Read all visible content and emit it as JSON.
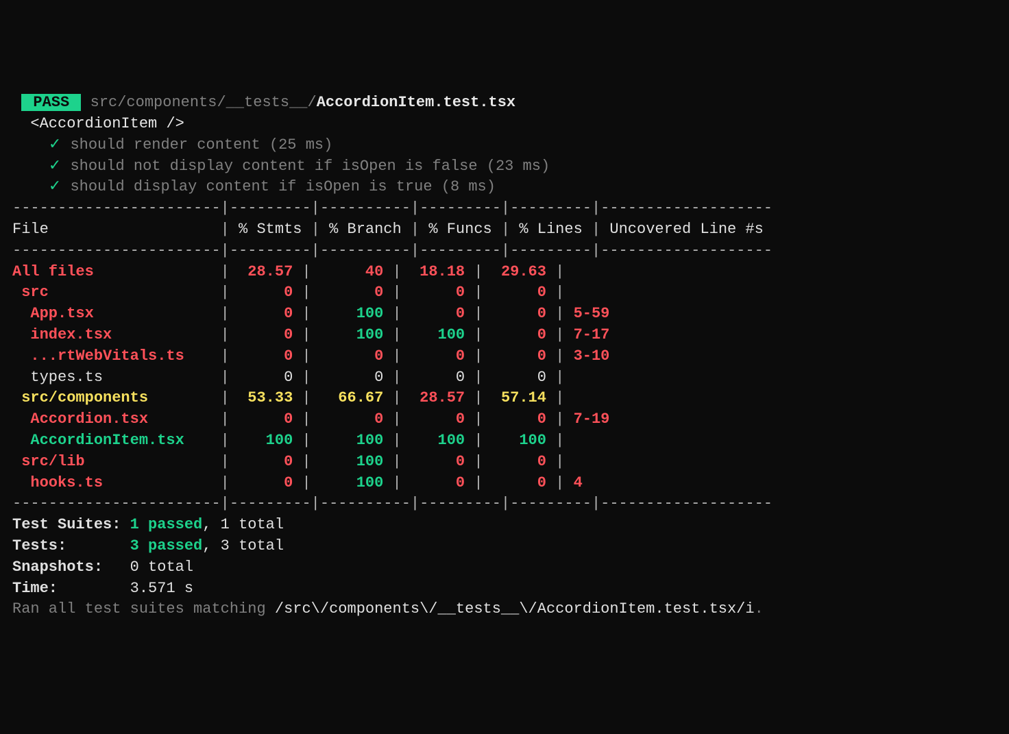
{
  "header": {
    "badge": " PASS ",
    "path_dim": "src/components/__tests__/",
    "path_bold": "AccordionItem.test.tsx"
  },
  "describe": "<AccordionItem />",
  "tests": [
    {
      "name": "should render content",
      "duration": "(25 ms)"
    },
    {
      "name": "should not display content if isOpen is false",
      "duration": "(23 ms)"
    },
    {
      "name": "should display content if isOpen is true",
      "duration": "(8 ms)"
    }
  ],
  "coverage": {
    "rule": "-----------------------|---------|----------|---------|---------|-------------------",
    "header": "File                   | % Stmts | % Branch | % Funcs | % Lines | Uncovered Line #s ",
    "rows": [
      {
        "file": "All files             ",
        "c": [
          "red",
          "red",
          "red",
          "red"
        ],
        "v": [
          "  28.57",
          "      40",
          "  18.18",
          "  29.63"
        ],
        "u": "",
        "fclass": "red"
      },
      {
        "file": " src                  ",
        "c": [
          "red",
          "red",
          "red",
          "red"
        ],
        "v": [
          "      0",
          "       0",
          "      0",
          "      0"
        ],
        "u": "",
        "fclass": "red"
      },
      {
        "file": "  App.tsx             ",
        "c": [
          "red",
          "green",
          "red",
          "red"
        ],
        "v": [
          "      0",
          "     100",
          "      0",
          "      0"
        ],
        "u": "5-59",
        "fclass": "red"
      },
      {
        "file": "  index.tsx           ",
        "c": [
          "red",
          "green",
          "green",
          "red"
        ],
        "v": [
          "      0",
          "     100",
          "    100",
          "      0"
        ],
        "u": "7-17",
        "fclass": "red"
      },
      {
        "file": "  ...rtWebVitals.ts   ",
        "c": [
          "red",
          "red",
          "red",
          "red"
        ],
        "v": [
          "      0",
          "       0",
          "      0",
          "      0"
        ],
        "u": "3-10",
        "fclass": "red"
      },
      {
        "file": "  types.ts            ",
        "c": [
          "fw",
          "fw",
          "fw",
          "fw"
        ],
        "v": [
          "      0",
          "       0",
          "      0",
          "      0"
        ],
        "u": "",
        "fclass": "fw"
      },
      {
        "file": " src/components       ",
        "c": [
          "yellow",
          "yellow",
          "red",
          "yellow"
        ],
        "v": [
          "  53.33",
          "   66.67",
          "  28.57",
          "  57.14"
        ],
        "u": "",
        "fclass": "yellow"
      },
      {
        "file": "  Accordion.tsx       ",
        "c": [
          "red",
          "red",
          "red",
          "red"
        ],
        "v": [
          "      0",
          "       0",
          "      0",
          "      0"
        ],
        "u": "7-19",
        "fclass": "red"
      },
      {
        "file": "  AccordionItem.tsx   ",
        "c": [
          "green",
          "green",
          "green",
          "green"
        ],
        "v": [
          "    100",
          "     100",
          "    100",
          "    100"
        ],
        "u": "",
        "fclass": "green"
      },
      {
        "file": " src/lib              ",
        "c": [
          "red",
          "green",
          "red",
          "red"
        ],
        "v": [
          "      0",
          "     100",
          "      0",
          "      0"
        ],
        "u": "",
        "fclass": "red"
      },
      {
        "file": "  hooks.ts            ",
        "c": [
          "red",
          "green",
          "red",
          "red"
        ],
        "v": [
          "      0",
          "     100",
          "      0",
          "      0"
        ],
        "u": "4",
        "fclass": "red"
      }
    ]
  },
  "summary": {
    "suites_label": "Test Suites: ",
    "suites_passed": "1 passed",
    "suites_rest": ", 1 total",
    "tests_label": "Tests:       ",
    "tests_passed": "3 passed",
    "tests_rest": ", 3 total",
    "snapshots_label": "Snapshots:   ",
    "snapshots_val": "0 total",
    "time_label": "Time:        ",
    "time_val": "3.571 s"
  },
  "footer": {
    "prefix": "Ran all test suites matching ",
    "pattern": "/src\\/components\\/__tests__\\/AccordionItem.test.tsx/i",
    "suffix": "."
  }
}
